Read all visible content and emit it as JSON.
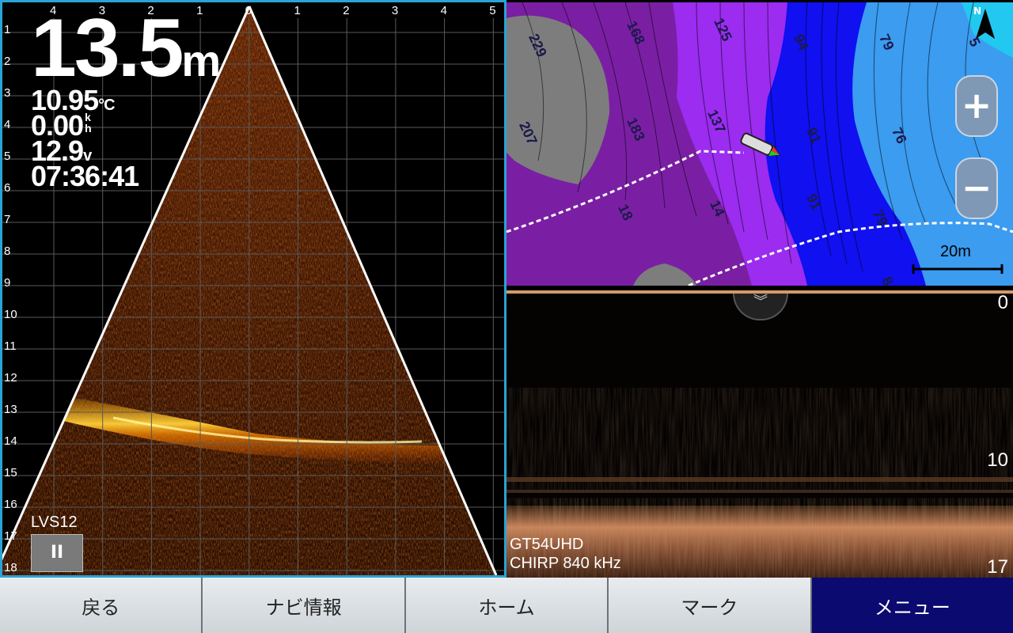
{
  "livescope": {
    "depth_value": "13.5",
    "depth_unit": "m",
    "water_temp": "10.95",
    "water_temp_unit": "°C",
    "speed": "0.00",
    "speed_unit_top": "k",
    "speed_unit_bottom": "h",
    "voltage": "12.9",
    "voltage_unit": "v",
    "time": "07:36:41",
    "model": "LVS12",
    "pause_label": "II",
    "x_axis_labels": [
      "4",
      "3",
      "2",
      "1",
      "0",
      "1",
      "2",
      "3",
      "4",
      "5"
    ],
    "y_axis_labels": [
      "1",
      "2",
      "3",
      "4",
      "5",
      "6",
      "7",
      "8",
      "9",
      "10",
      "11",
      "12",
      "13",
      "14",
      "15",
      "16",
      "17",
      "18"
    ]
  },
  "chart": {
    "zoom_in_label": "+",
    "zoom_out_label": "−",
    "scale_label": "20m",
    "north_label": "N",
    "contour_labels": [
      "229",
      "168",
      "125",
      "94",
      "79",
      "207",
      "183",
      "137",
      "91",
      "76",
      "18",
      "14",
      "91",
      "79",
      "8",
      "5"
    ]
  },
  "sonar": {
    "scale_top": "0",
    "scale_mid": "10",
    "scale_bottom": "17",
    "transducer": "GT54UHD",
    "frequency": "CHIRP 840 kHz"
  },
  "menu": {
    "back": "戻る",
    "nav_info": "ナビ情報",
    "home": "ホーム",
    "mark": "マーク",
    "menu": "メニュー"
  },
  "colors": {
    "pane_border": "#2aa3d6",
    "menu_active": "#0a0a70",
    "deep_purple": "#7a1fa3",
    "mid_purple": "#9b2cf0",
    "blue": "#1010f0",
    "light_blue": "#3b9cf0"
  }
}
